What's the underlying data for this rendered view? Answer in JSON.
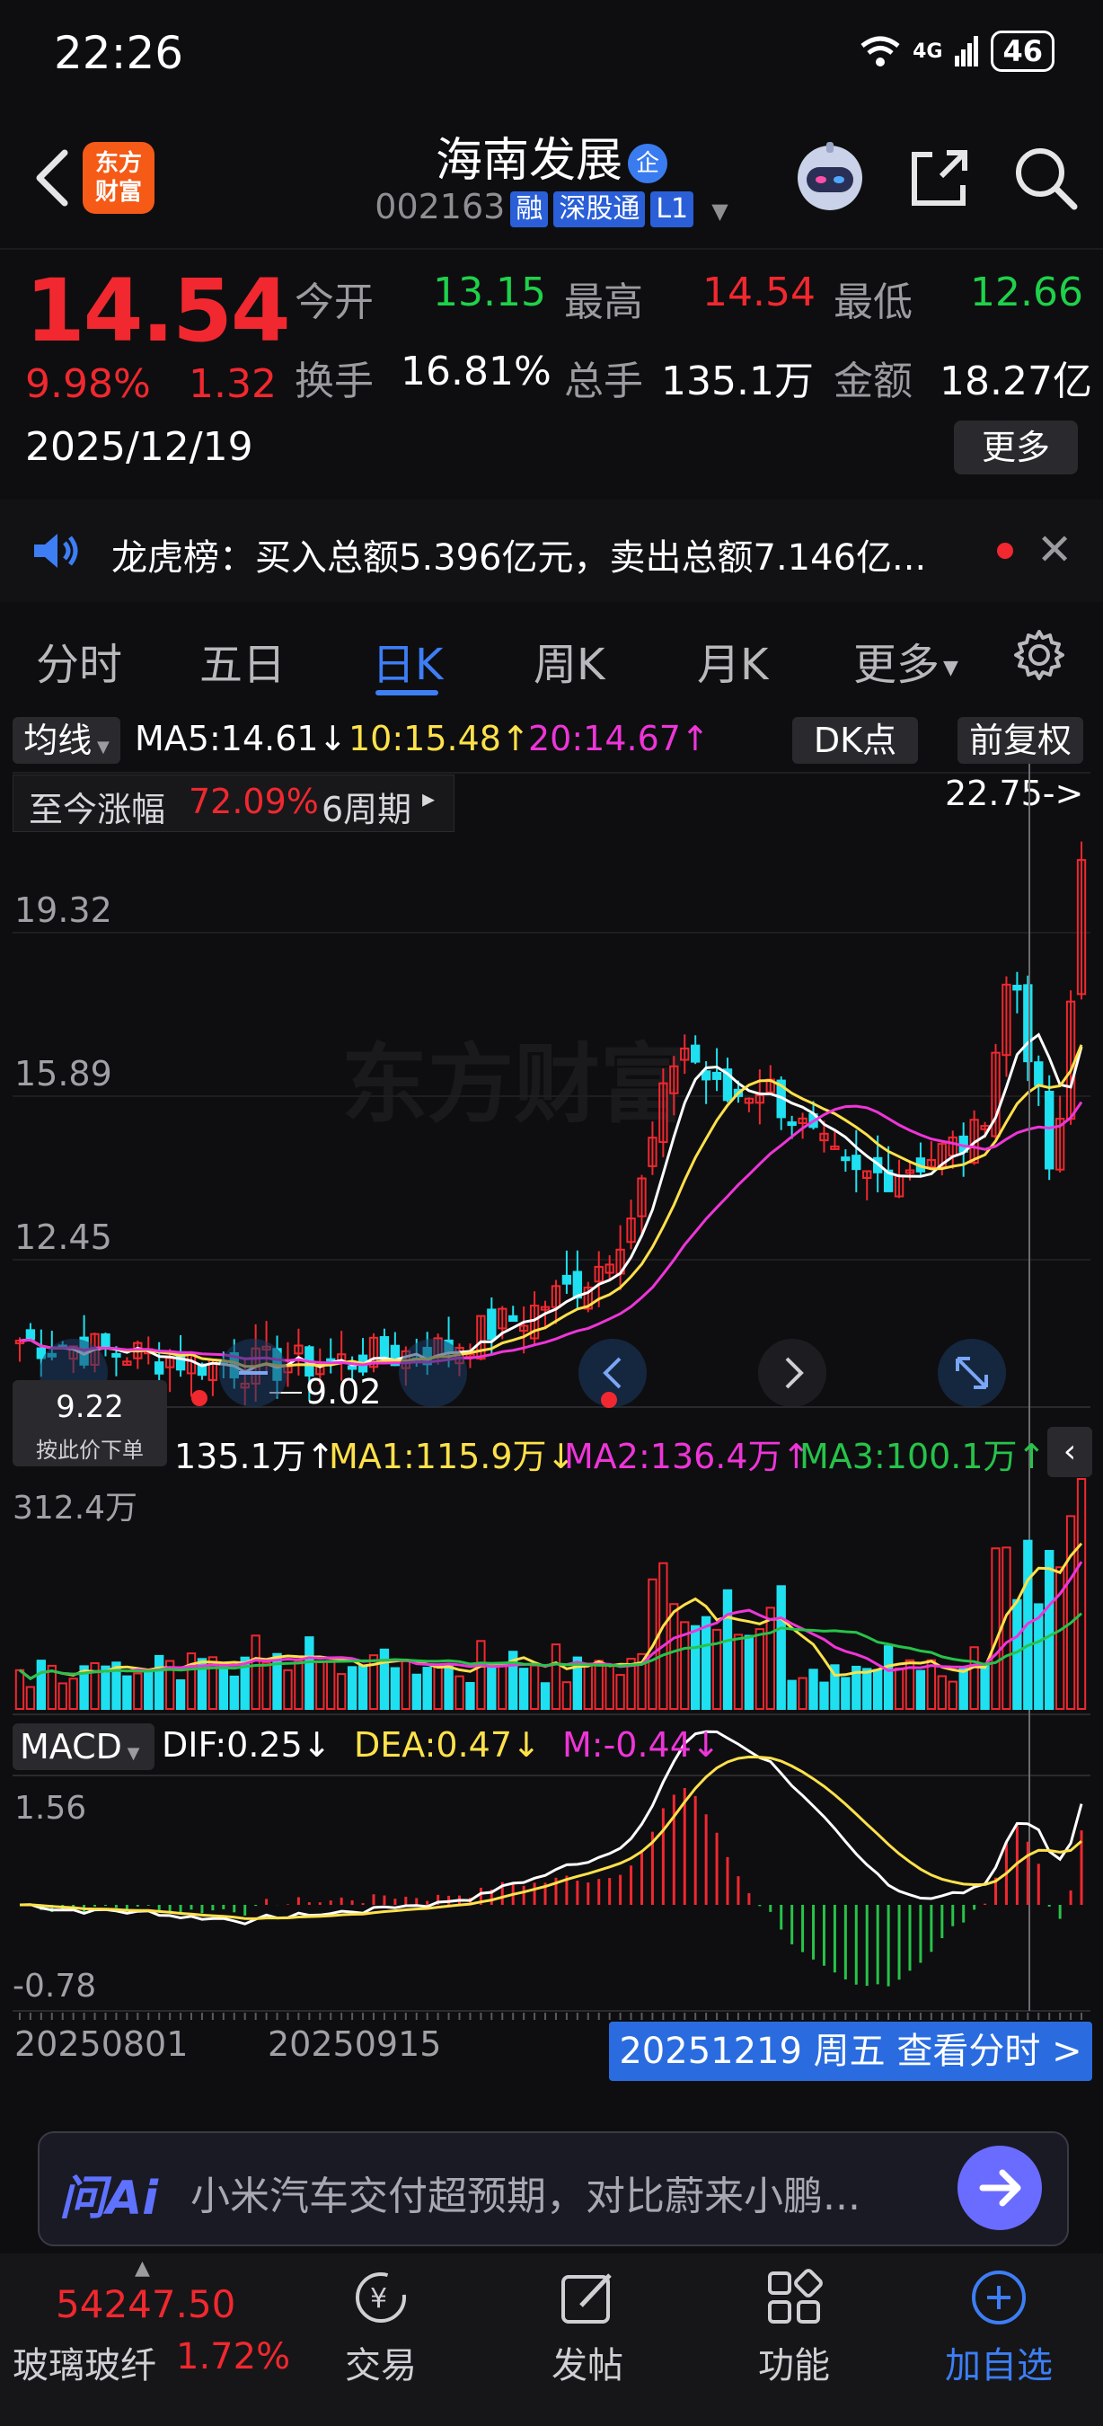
{
  "status": {
    "time": "22:26",
    "network": "4G",
    "battery": "46"
  },
  "header": {
    "logo": "东方\n财富",
    "name": "海南发展",
    "enterprise_badge": "企",
    "code": "002163",
    "tags": [
      "融",
      "深股通",
      "L1"
    ]
  },
  "quote": {
    "price": "14.54",
    "pct": "9.98%",
    "change": "1.32",
    "date": "2025/12/19",
    "open_label": "今开",
    "open": "13.15",
    "high_label": "最高",
    "high": "14.54",
    "low_label": "最低",
    "low": "12.66",
    "turnover_label": "换手",
    "turnover": "16.81%",
    "volume_label": "总手",
    "volume": "135.1万",
    "amount_label": "金额",
    "amount": "18.27亿",
    "more": "更多"
  },
  "notice": {
    "text": "龙虎榜：买入总额5.396亿元，卖出总额7.146亿..."
  },
  "tabs": [
    "分时",
    "五日",
    "日K",
    "周K",
    "月K",
    "更多"
  ],
  "active_tab": "日K",
  "ma_row": {
    "selector": "均线",
    "ma5": "MA5:14.61↓",
    "ma10": "10:15.48↑",
    "ma20": "20:14.67↑",
    "dk": "DK点",
    "adjust": "前复权"
  },
  "range_box": {
    "label": "至今涨幅",
    "value": "72.09%",
    "period": "6周期"
  },
  "price_axis": {
    "high_marker": "22.75->",
    "ticks": [
      "19.32",
      "15.89",
      "12.45"
    ],
    "low_marker": "9.02"
  },
  "cursor": {
    "price": "9.22",
    "hint": "按此价下单"
  },
  "volume_row": {
    "vol": "135.1万↑",
    "ma1": "MA1:115.9万↓",
    "ma2": "MA2:136.4万↑",
    "ma3": "MA3:100.1万↑",
    "max": "312.4万"
  },
  "macd_row": {
    "label": "MACD",
    "dif": "DIF:0.25↓",
    "dea": "DEA:0.47↓",
    "m": "M:-0.44↓",
    "top": "1.56",
    "bottom": "-0.78"
  },
  "date_axis": {
    "d1": "20250801",
    "d2": "20250915",
    "view": "20251219 周五 查看分时 >"
  },
  "watermark": "东方财富",
  "ai": {
    "logo": "问Ai",
    "text": "小米汽车交付超预期，对比蔚来小鹏..."
  },
  "nav": {
    "index_value": "54247.50",
    "index_name": "玻璃玻纤",
    "index_pct": "1.72%",
    "items": [
      "交易",
      "发帖",
      "功能",
      "加自选"
    ]
  },
  "colors": {
    "up": "#f1282f",
    "down": "#1fd14a",
    "accent": "#3d7ef5",
    "ma5": "#ffffff",
    "ma10": "#ffe14a",
    "ma20": "#ee35d8",
    "bear_candle": "#1fe0f0"
  }
}
